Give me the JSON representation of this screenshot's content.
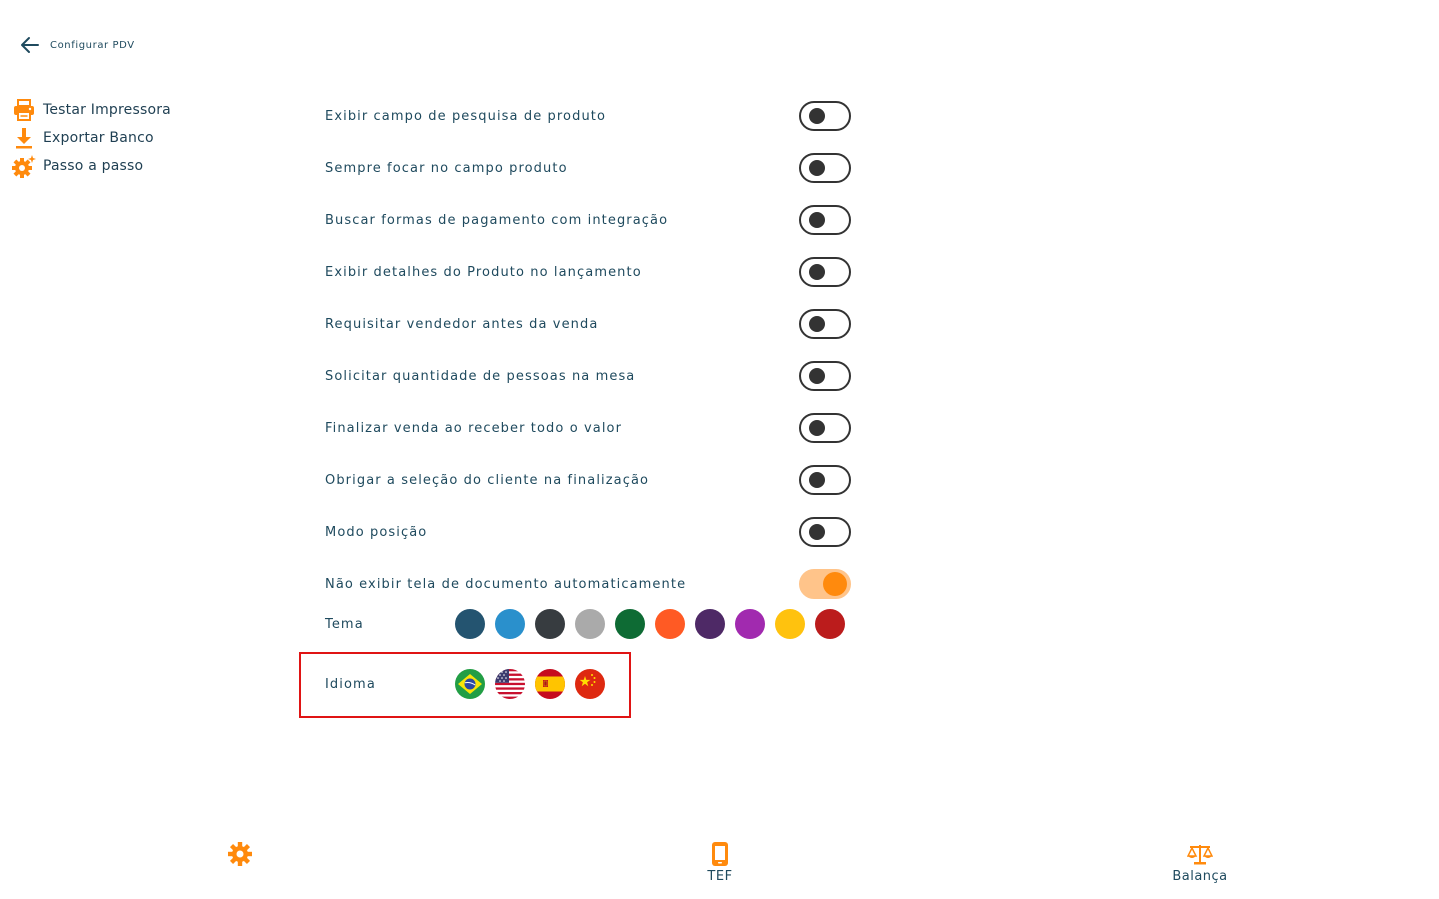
{
  "header": {
    "title": "Configurar PDV",
    "back_icon": "arrow-left-icon"
  },
  "side_menu": [
    {
      "label": "Testar Impressora",
      "icon": "printer-icon"
    },
    {
      "label": "Exportar Banco",
      "icon": "download-icon"
    },
    {
      "label": "Passo a passo",
      "icon": "gear-sparkle-icon"
    }
  ],
  "settings": [
    {
      "label": "Exibir campo de pesquisa de produto",
      "enabled": false
    },
    {
      "label": "Sempre focar no campo produto",
      "enabled": false
    },
    {
      "label": "Buscar formas de pagamento com integração",
      "enabled": false
    },
    {
      "label": "Exibir detalhes do Produto no lançamento",
      "enabled": false
    },
    {
      "label": "Requisitar vendedor antes da venda",
      "enabled": false
    },
    {
      "label": "Solicitar quantidade de pessoas na mesa",
      "enabled": false
    },
    {
      "label": "Finalizar venda ao receber todo o valor",
      "enabled": false
    },
    {
      "label": "Obrigar a seleção do cliente na finalização",
      "enabled": false
    },
    {
      "label": "Modo posição",
      "enabled": false
    },
    {
      "label": "Não exibir tela de documento automaticamente",
      "enabled": true
    }
  ],
  "theme": {
    "label": "Tema",
    "colors": [
      "#245470",
      "#2a90cc",
      "#373c40",
      "#aaaaaa",
      "#0e6b34",
      "#ff5a24",
      "#4e2966",
      "#a12aaf",
      "#ffc20e",
      "#bb1c1c"
    ]
  },
  "language": {
    "label": "Idioma",
    "flags": [
      "brazil-flag-icon",
      "usa-flag-icon",
      "spain-flag-icon",
      "china-flag-icon"
    ]
  },
  "bottom_nav": [
    {
      "label": "",
      "icon": "gear-icon"
    },
    {
      "label": "TEF",
      "icon": "phone-icon"
    },
    {
      "label": "Balança",
      "icon": "scale-icon"
    }
  ],
  "colors": {
    "accent": "#ff8a0d",
    "text": "#1f4a5e",
    "highlight_border": "#e01414"
  }
}
